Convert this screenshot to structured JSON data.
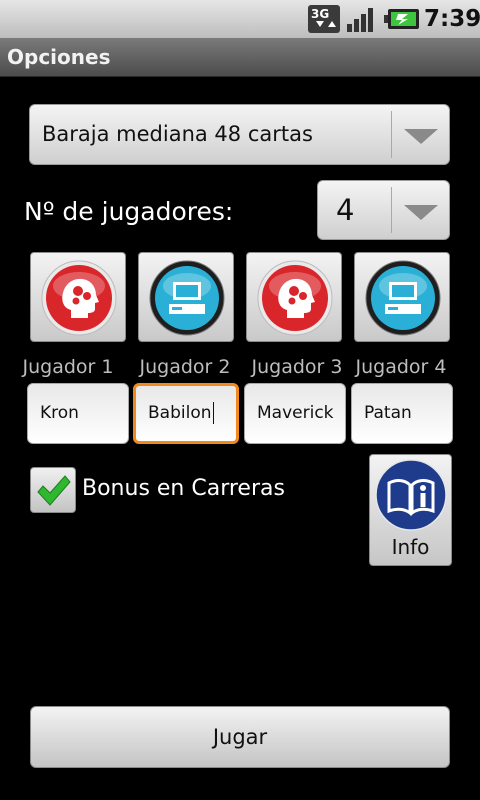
{
  "status_bar": {
    "network": "3G",
    "time": "7:39"
  },
  "title_bar": {
    "title": "Opciones"
  },
  "deck_spinner": {
    "selected": "Baraja mediana 48 cartas"
  },
  "players": {
    "label": "Nº de jugadores:",
    "count_selected": "4",
    "list": [
      {
        "label": "Jugador 1",
        "name": "Kron",
        "type": "human",
        "icon": "brain-icon"
      },
      {
        "label": "Jugador 2",
        "name": "Babilon",
        "type": "computer",
        "icon": "computer-icon"
      },
      {
        "label": "Jugador 3",
        "name": "Maverick",
        "type": "human",
        "icon": "brain-icon"
      },
      {
        "label": "Jugador 4",
        "name": "Patan",
        "type": "computer",
        "icon": "computer-icon"
      }
    ]
  },
  "bonus": {
    "label": "Bonus en Carreras",
    "checked": true
  },
  "info_button": {
    "label": "Info",
    "icon": "book-info-icon"
  },
  "play_button": {
    "label": "Jugar"
  },
  "colors": {
    "focus": "#f08a1e",
    "human_icon": "#d9262a",
    "computer_icon": "#2ab0d6",
    "info_icon": "#1f3b8c",
    "check": "#2fb82f"
  }
}
